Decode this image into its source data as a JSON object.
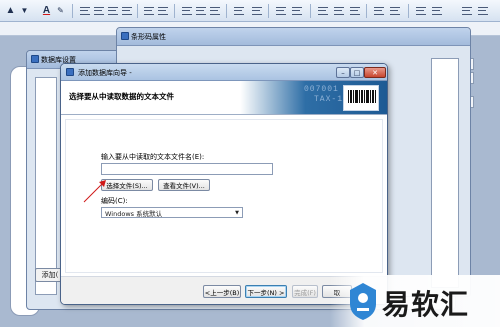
{
  "toolbar": {
    "font_color_glyph": "A",
    "bold_glyph": "A"
  },
  "db_window": {
    "title": "数据库设置",
    "add_button": "添加("
  },
  "barcode_window": {
    "title": "条形码属性"
  },
  "wizard": {
    "title": "添加数据库向导 -",
    "header": "选择要从中读取数据的文本文件",
    "header_art_line1": "007001",
    "header_art_line2": "TAX-1-",
    "field_label": "输入要从中读取的文本文件名(E):",
    "field_value": "",
    "select_file_button": "选择文件(S)...",
    "view_file_button": "查看文件(V)...",
    "encoding_label": "编码(C):",
    "encoding_value": "Windows 系统默认",
    "back_button": "<上一步(B)",
    "next_button": "下一步(N) >",
    "finish_button": "完成(F)",
    "cancel_button": "取"
  },
  "watermark": {
    "text": "易软汇"
  }
}
